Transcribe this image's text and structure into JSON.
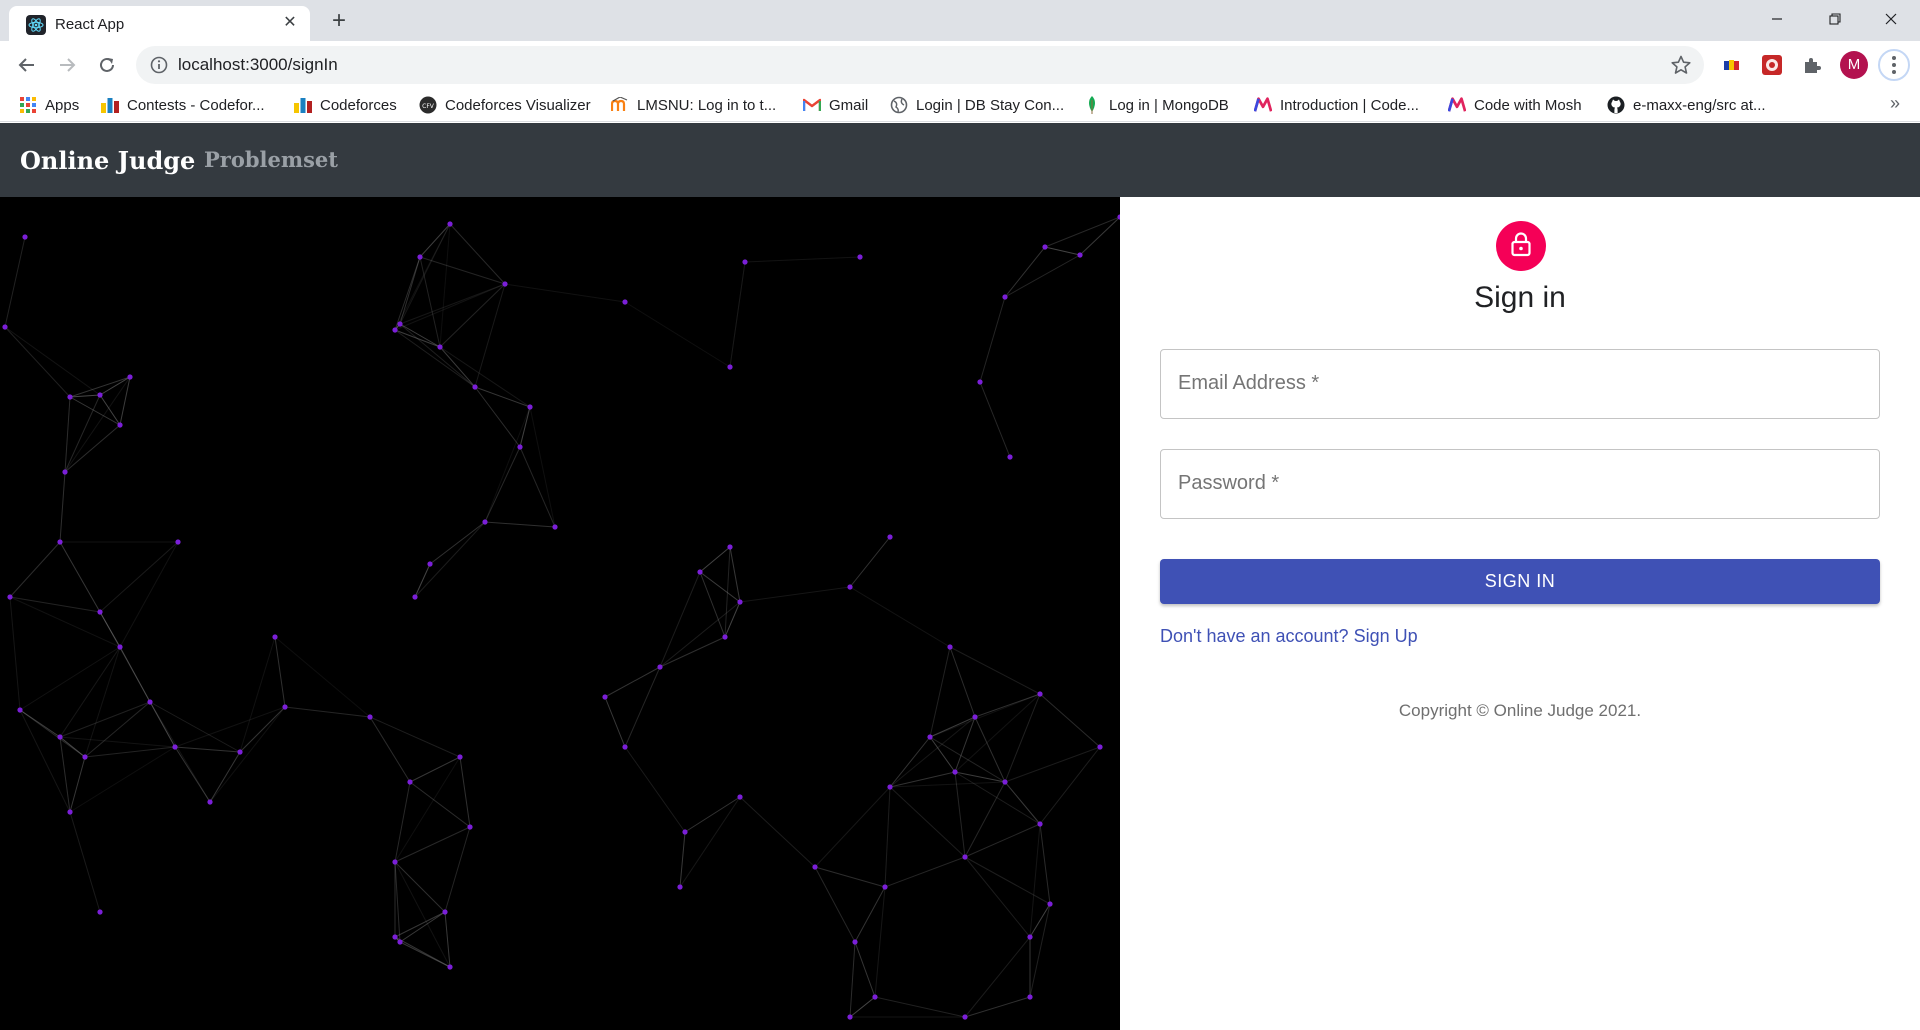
{
  "browser": {
    "tab_title": "React App",
    "url": "localhost:3000/signIn",
    "profile_initial": "M"
  },
  "bookmarks": [
    {
      "label": "Apps",
      "icon": "apps-grid-icon"
    },
    {
      "label": "Contests - Codefor...",
      "icon": "codeforces-icon"
    },
    {
      "label": "Codeforces",
      "icon": "codeforces-icon"
    },
    {
      "label": "Codeforces Visualizer",
      "icon": "cfv-icon"
    },
    {
      "label": "LMSNU: Log in to t...",
      "icon": "moodle-icon"
    },
    {
      "label": "Gmail",
      "icon": "gmail-icon"
    },
    {
      "label": "Login | DB Stay Con...",
      "icon": "globe-icon"
    },
    {
      "label": "Log in | MongoDB",
      "icon": "mongodb-leaf-icon"
    },
    {
      "label": "Introduction | Code...",
      "icon": "mosh-icon"
    },
    {
      "label": "Code with Mosh",
      "icon": "mosh-icon"
    },
    {
      "label": "e-maxx-eng/src at...",
      "icon": "github-icon"
    }
  ],
  "app": {
    "brand": "Online Judge",
    "nav_problemset": "Problemset"
  },
  "signin": {
    "title": "Sign in",
    "email_label": "Email Address *",
    "password_label": "Password *",
    "button": "SIGN IN",
    "signup_link": "Don't have an account? Sign Up",
    "copyright": "Copyright © Online Judge 2021."
  },
  "colors": {
    "appbar": "#343a40",
    "lock_avatar": "#f50057",
    "primary": "#3f51b5",
    "particle": "#7b1fd8"
  }
}
